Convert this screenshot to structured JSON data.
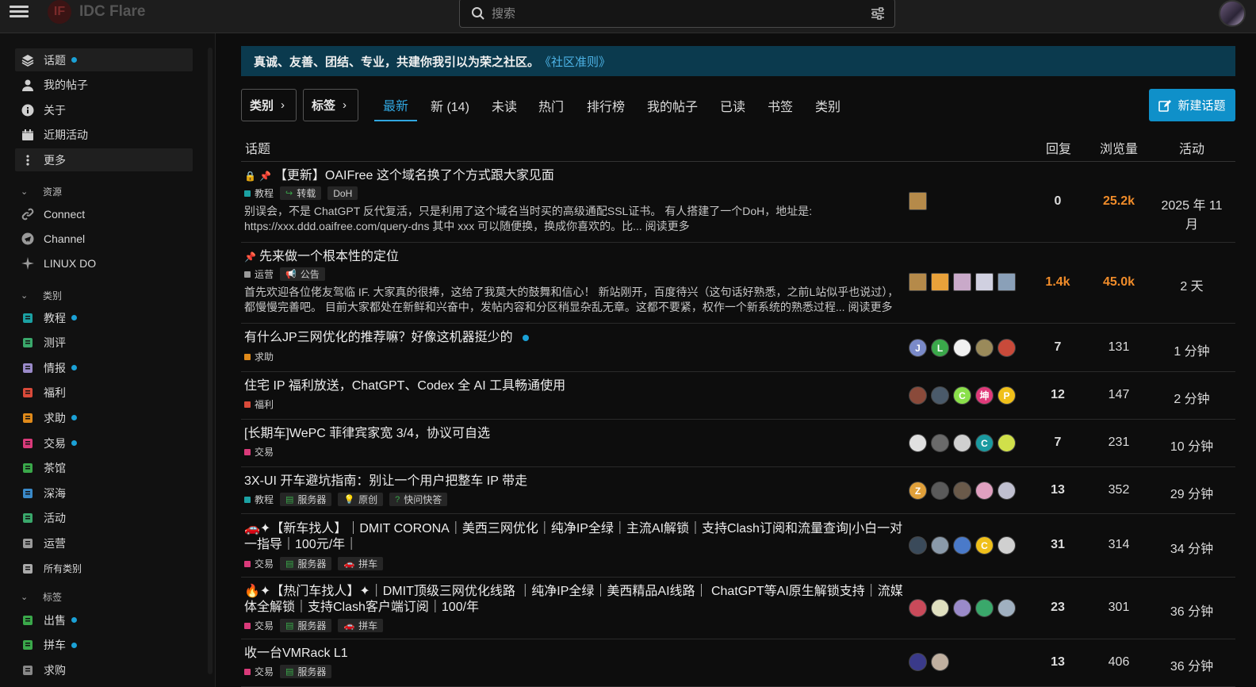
{
  "header": {
    "logo_mark": "IF",
    "logo_text": "IDC Flare",
    "search_placeholder": "搜索"
  },
  "sidebar": {
    "items": [
      {
        "label": "话题",
        "active": true,
        "dot": true,
        "icon": "layers-icon"
      },
      {
        "label": "我的帖子",
        "icon": "user-icon"
      },
      {
        "label": "关于",
        "icon": "info-icon"
      },
      {
        "label": "近期活动",
        "icon": "calendar-icon"
      },
      {
        "label": "更多",
        "icon": "more-vertical-icon",
        "active": true
      }
    ],
    "resources_title": "资源",
    "resources": [
      {
        "label": "Connect",
        "icon": "link-icon"
      },
      {
        "label": "Channel",
        "icon": "telegram-icon"
      },
      {
        "label": "LINUX DO",
        "icon": "sparkle-icon"
      }
    ],
    "categories_title": "类别",
    "categories": [
      {
        "label": "教程",
        "dot": true,
        "color": "#1ba1a3"
      },
      {
        "label": "测评",
        "dot": false,
        "color": "#3aa86b"
      },
      {
        "label": "情报",
        "dot": true,
        "color": "#9a8ac9"
      },
      {
        "label": "福利",
        "dot": false,
        "color": "#d94a3a"
      },
      {
        "label": "求助",
        "dot": true,
        "color": "#e08a1a"
      },
      {
        "label": "交易",
        "dot": true,
        "color": "#d93a7a"
      },
      {
        "label": "茶馆",
        "dot": false,
        "color": "#3aa84a"
      },
      {
        "label": "深海",
        "dot": false,
        "color": "#3a8ac9"
      },
      {
        "label": "活动",
        "dot": false,
        "color": "#3aa86b"
      },
      {
        "label": "运营",
        "dot": false,
        "color": "#9a9a9a"
      },
      {
        "label": "所有类别",
        "dot": false,
        "color": "#aaaaaa"
      }
    ],
    "tags_title": "标签",
    "tags": [
      {
        "label": "出售",
        "dot": true,
        "color": "#3aa84a"
      },
      {
        "label": "拼车",
        "dot": true,
        "color": "#3aa84a"
      },
      {
        "label": "求购",
        "dot": false,
        "color": "#888888"
      }
    ]
  },
  "banner": {
    "text": "真诚、友善、团结、专业，共建你我引以为荣之社区。",
    "link": "《社区准则》"
  },
  "nav": {
    "category_dropdown": "类别",
    "tag_dropdown": "标签",
    "tabs": [
      "最新",
      "新 (14)",
      "未读",
      "热门",
      "排行榜",
      "我的帖子",
      "已读",
      "书签",
      "类别"
    ],
    "new_topic": "新建话题"
  },
  "table_header": {
    "topic": "话题",
    "replies": "回复",
    "views": "浏览量",
    "activity": "活动"
  },
  "topics": [
    {
      "title": "【更新】OAIFree 这个域名换了个方式跟大家见面",
      "pinned": true,
      "locked": true,
      "category": "教程",
      "cat_color": "#1ba1a3",
      "tags": [
        {
          "icon": "share-icon",
          "label": "转载"
        },
        {
          "label": "DoH"
        }
      ],
      "excerpt": "别误会，不是 ChatGPT 反代复活，只是利用了这个域名当时买的高级通配SSL证书。 有人搭建了一个DoH，地址是: https://xxx.ddd.oaifree.com/query-dns 其中 xxx 可以随便换，换成你喜欢的。比... 阅读更多",
      "replies": "0",
      "views": "25.2k",
      "activity": "2025 年 11月",
      "views_hot": true,
      "poster_colors": [
        "#b58a4a"
      ]
    },
    {
      "title": "先来做一个根本性的定位",
      "pinned": true,
      "category": "运营",
      "cat_color": "#9a9a9a",
      "tags": [
        {
          "icon": "megaphone-icon",
          "label": "公告"
        }
      ],
      "excerpt": "首先欢迎各位佬友驾临 IF. 大家真的很捧，这给了我莫大的鼓舞和信心！ 新站刚开，百度待兴（这句话好熟悉，之前L站似乎也说过），都慢慢完善吧。 目前大家都处在新鲜和兴奋中，发帖内容和分区稍显杂乱无章。这都不要紧，权作一个新系统的熟悉过程... 阅读更多",
      "replies": "1.4k",
      "views": "45.0k",
      "activity": "2 天",
      "replies_hot": true,
      "views_hot": true,
      "poster_colors": [
        "#b58a4a",
        "#e8a13a",
        "#c9a9c9",
        "#d0d0e0",
        "#8aa0b8"
      ]
    },
    {
      "title": "有什么JP三网优化的推荐嘛？好像这机器挺少的",
      "unread": true,
      "category": "求助",
      "cat_color": "#e08a1a",
      "tags": [],
      "replies": "7",
      "views": "131",
      "activity": "1 分钟",
      "poster_colors": [
        "#7a8ac9",
        "#3aa84a",
        "#f0f0f0",
        "#9a8a5a",
        "#c94a3a"
      ],
      "poster_letters": [
        "J",
        "L",
        "",
        "",
        ""
      ]
    },
    {
      "title": "住宅 IP 福利放送，ChatGPT、Codex 全 AI 工具畅通使用",
      "category": "福利",
      "cat_color": "#d94a3a",
      "tags": [],
      "replies": "12",
      "views": "147",
      "activity": "2 分钟",
      "poster_colors": [
        "#8a4a3a",
        "#4a5a6a",
        "#8ae04a",
        "#e03a7a",
        "#f0c01a"
      ],
      "poster_letters": [
        "",
        "",
        "C",
        "坤",
        "P"
      ]
    },
    {
      "title": "[长期车]WePC 菲律宾家宽 3/4，协议可自选",
      "category": "交易",
      "cat_color": "#d93a7a",
      "tags": [],
      "replies": "7",
      "views": "231",
      "activity": "10 分钟",
      "poster_colors": [
        "#e0e0e0",
        "#6a6a6a",
        "#d0d0d0",
        "#1a9aa0",
        "#d0e04a"
      ],
      "poster_letters": [
        "",
        "",
        "",
        "C",
        ""
      ]
    },
    {
      "title": "3X-UI 开车避坑指南：别让一个用户把整车 IP 带走",
      "category": "教程",
      "cat_color": "#1ba1a3",
      "tags": [
        {
          "icon": "server-icon",
          "label": "服务器"
        },
        {
          "icon": "bulb-icon",
          "label": "原创"
        },
        {
          "icon": "question-icon",
          "label": "快问快答"
        }
      ],
      "replies": "13",
      "views": "352",
      "activity": "29 分钟",
      "poster_colors": [
        "#e0a03a",
        "#5a5a5a",
        "#6a5a4a",
        "#e0a0c0",
        "#c0c0d0"
      ],
      "poster_letters": [
        "Z",
        "",
        "",
        "",
        ""
      ]
    },
    {
      "title": "🚗✦【新车找人】｜DMIT CORONA｜美西三网优化｜纯净IP全绿｜主流AI解锁｜支持Clash订阅和流量查询|小白一对一指导｜100元/年｜",
      "category": "交易",
      "cat_color": "#d93a7a",
      "tags": [
        {
          "icon": "server-icon",
          "label": "服务器"
        },
        {
          "icon": "car-icon",
          "label": "拼车"
        }
      ],
      "replies": "31",
      "views": "314",
      "activity": "34 分钟",
      "poster_colors": [
        "#3a4a5a",
        "#8a9aaa",
        "#4a7ac9",
        "#f0c01a",
        "#d0d0d0"
      ],
      "poster_letters": [
        "",
        "",
        "",
        "C",
        ""
      ]
    },
    {
      "title": "🔥✦【热门车找人】✦｜DMIT顶级三网优化线路 ｜纯净IP全绿｜美西精品AI线路｜ ChatGPT等AI原生解锁支持｜流媒体全解锁｜支持Clash客户端订阅｜100/年",
      "category": "交易",
      "cat_color": "#d93a7a",
      "tags": [
        {
          "icon": "server-icon",
          "label": "服务器"
        },
        {
          "icon": "car-icon",
          "label": "拼车"
        }
      ],
      "replies": "23",
      "views": "301",
      "activity": "36 分钟",
      "poster_colors": [
        "#c94a5a",
        "#e0e0c0",
        "#9a8ac9",
        "#3aa86b",
        "#a0b0c0"
      ],
      "poster_letters": [
        "",
        "",
        "",
        "",
        ""
      ]
    },
    {
      "title": "收一台VMRack L1",
      "category": "交易",
      "cat_color": "#d93a7a",
      "tags": [
        {
          "icon": "server-icon",
          "label": "服务器"
        }
      ],
      "replies": "13",
      "views": "406",
      "activity": "36 分钟",
      "poster_colors": [
        "#3a3a8a",
        "#c0b0a0"
      ],
      "poster_letters": [
        "",
        ""
      ]
    }
  ]
}
